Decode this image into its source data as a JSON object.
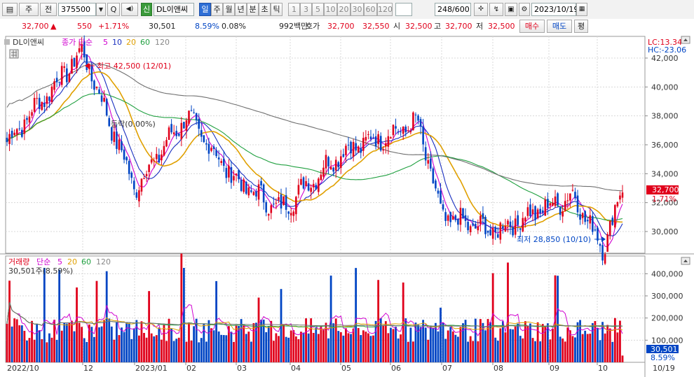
{
  "toolbar": {
    "menu_glyph": "▤",
    "mode": "주",
    "prefix": "전",
    "code": "375500",
    "search_glyph": "Q",
    "sound_glyph": "◀)",
    "new_badge": "신",
    "stock_name": "DL이앤씨",
    "periods": [
      "일",
      "주",
      "월",
      "년",
      "분",
      "초",
      "틱"
    ],
    "active_period": "일",
    "numbers": [
      "1",
      "3",
      "5",
      "10",
      "20",
      "30",
      "60",
      "120"
    ],
    "count": "248",
    "count_total": "/600",
    "date": "2023/10/19"
  },
  "quote": {
    "price": "32,700",
    "arrow": "▲",
    "change": "550",
    "change_rate": "+1.71%",
    "volume": "30,501",
    "rate1": "8.59%",
    "rate2": "0.08%",
    "amount": "992백만",
    "bid_label": "호가",
    "bid1": "32,700",
    "bid2": "32,550",
    "open_label": "시",
    "open": "32,500",
    "high_label": "고",
    "high": "32,700",
    "low_label": "저",
    "low": "32,500",
    "buy_label": "매수",
    "sell_label": "매도",
    "eval_label": "평"
  },
  "price_pane": {
    "legend_name": "DL이앤씨",
    "legend_label": "종가 단순",
    "ma_periods": [
      "5",
      "10",
      "20",
      "60",
      "120"
    ],
    "lc_label": "LC:13.34",
    "hc_label": "HC:-23.06",
    "high_annotation": "최고 42,500 (12/01)",
    "low_annotation": "최저 28,850 (10/10)",
    "mid_annotation": "등락(0.00%)",
    "current_price": "32,700",
    "current_rate": "1.71%"
  },
  "volume_pane": {
    "legend_label": "거래량",
    "legend_ma_label": "단순",
    "ma_periods": [
      "5",
      "20",
      "60",
      "120"
    ],
    "current_label": "30,501주(8.59%)",
    "current_value": "30,501",
    "current_rate": "8.59%"
  },
  "x_axis_labels": [
    "2022/10",
    "12",
    "2023/01",
    "02",
    "03",
    "04",
    "05",
    "06",
    "07",
    "08",
    "09",
    "10",
    "10/19"
  ],
  "colors": {
    "up": "#e0001b",
    "down": "#0045c4",
    "ma5": "#d000d0",
    "ma10": "#1a30c0",
    "ma20": "#e0a000",
    "ma60": "#20a040",
    "ma120": "#707070"
  },
  "chart_data": [
    {
      "type": "candlestick",
      "title": "DL이앤씨 일봉",
      "ylim": [
        28500,
        43500
      ],
      "y_ticks": [
        30000,
        32000,
        34000,
        36000,
        38000,
        40000,
        42000
      ],
      "x_ticks": [
        "2022/10",
        "12",
        "2023/01",
        "02",
        "03",
        "04",
        "05",
        "06",
        "07",
        "08",
        "09",
        "10"
      ],
      "key_points": [
        {
          "label": "start",
          "date": "2022/10",
          "close": 36200
        },
        {
          "label": "high",
          "date": "2022/12/01",
          "close": 42500
        },
        {
          "label": "2023/01",
          "date": "2023/01",
          "close": 33000
        },
        {
          "label": "02",
          "date": "2023/02",
          "close": 38000
        },
        {
          "label": "03",
          "date": "2023/03",
          "close": 33500
        },
        {
          "label": "04",
          "date": "2023/04",
          "close": 31500
        },
        {
          "label": "05",
          "date": "2023/05",
          "close": 35500
        },
        {
          "label": "06",
          "date": "2023/06",
          "close": 37500
        },
        {
          "label": "07",
          "date": "2023/07",
          "close": 31000
        },
        {
          "label": "08",
          "date": "2023/08",
          "close": 30000
        },
        {
          "label": "09",
          "date": "2023/09",
          "close": 32500
        },
        {
          "label": "low",
          "date": "2023/10/10",
          "close": 28850
        },
        {
          "label": "last",
          "date": "2023/10/19",
          "close": 32700
        }
      ]
    },
    {
      "type": "bar",
      "title": "거래량",
      "ylim": [
        0,
        480000
      ],
      "y_ticks": [
        100000,
        200000,
        300000,
        400000
      ],
      "last_value": 30501
    }
  ]
}
